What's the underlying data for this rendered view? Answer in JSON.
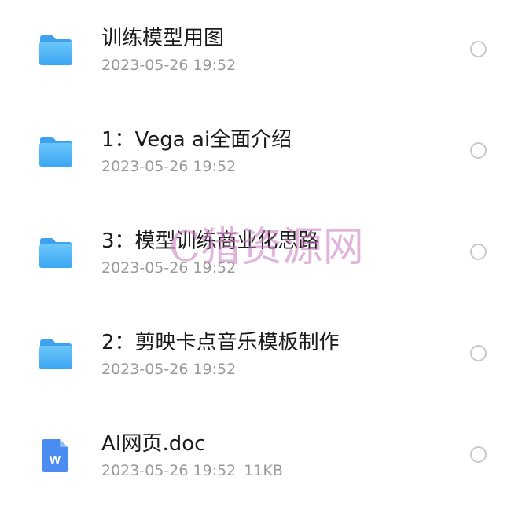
{
  "files": [
    {
      "type": "folder",
      "name": "训练模型用图",
      "date": "2023-05-26 19:52",
      "size": ""
    },
    {
      "type": "folder",
      "name": "1：Vega ai全面介绍",
      "date": "2023-05-26 19:52",
      "size": ""
    },
    {
      "type": "folder",
      "name": "3：模型训练商业化思路",
      "date": "2023-05-26 19:52",
      "size": ""
    },
    {
      "type": "folder",
      "name": "2：剪映卡点音乐模板制作",
      "date": "2023-05-26 19:52",
      "size": ""
    },
    {
      "type": "doc",
      "name": "AI网页.doc",
      "date": "2023-05-26 19:52",
      "size": "11KB"
    }
  ],
  "icons": {
    "folder": "folder-icon",
    "doc": "word-document-icon",
    "doc_letter": "W"
  },
  "watermark": "C猎资源网",
  "colors": {
    "folder": "#4db3f6",
    "doc": "#4a8cf0",
    "title": "#1a1a1a",
    "meta": "#9a9a9a"
  }
}
